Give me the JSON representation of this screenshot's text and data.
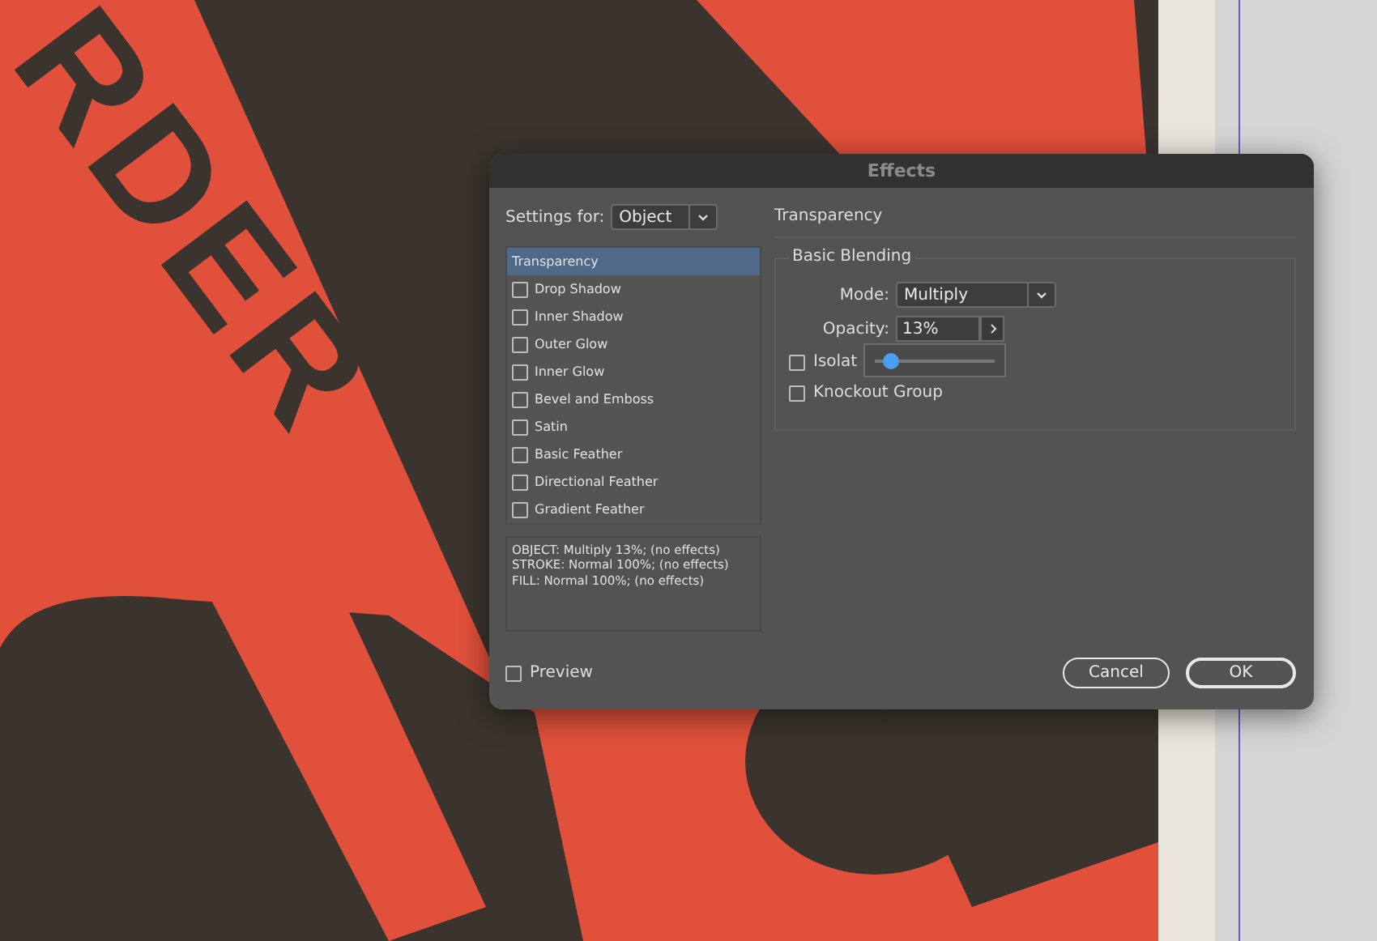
{
  "artwork": {
    "headline": "RDER"
  },
  "dialog": {
    "title": "Effects",
    "settings_for": {
      "label": "Settings for:",
      "value": "Object"
    },
    "effects": [
      {
        "kind": "plain",
        "label": "Transparency",
        "selected": true
      },
      {
        "kind": "checkbox",
        "label": "Drop Shadow",
        "checked": false,
        "selected": false
      },
      {
        "kind": "checkbox",
        "label": "Inner Shadow",
        "checked": false,
        "selected": false
      },
      {
        "kind": "checkbox",
        "label": "Outer Glow",
        "checked": false,
        "selected": false
      },
      {
        "kind": "checkbox",
        "label": "Inner Glow",
        "checked": false,
        "selected": false
      },
      {
        "kind": "checkbox",
        "label": "Bevel and Emboss",
        "checked": false,
        "selected": false
      },
      {
        "kind": "checkbox",
        "label": "Satin",
        "checked": false,
        "selected": false
      },
      {
        "kind": "checkbox",
        "label": "Basic Feather",
        "checked": false,
        "selected": false
      },
      {
        "kind": "checkbox",
        "label": "Directional Feather",
        "checked": false,
        "selected": false
      },
      {
        "kind": "checkbox",
        "label": "Gradient Feather",
        "checked": false,
        "selected": false
      }
    ],
    "summary": [
      "OBJECT: Multiply 13%; (no effects)",
      "STROKE: Normal 100%; (no effects)",
      "FILL: Normal 100%; (no effects)"
    ],
    "preview": {
      "label": "Preview",
      "checked": false
    },
    "section_title": "Transparency",
    "group_title": "Basic Blending",
    "mode": {
      "label": "Mode:",
      "value": "Multiply"
    },
    "opacity": {
      "label": "Opacity:",
      "value": "13%",
      "level": 0.13
    },
    "options": [
      {
        "label": "Isolat",
        "checked": false
      },
      {
        "label": "Knockout Group",
        "checked": false
      }
    ],
    "buttons": [
      {
        "label": "Cancel",
        "default": false
      },
      {
        "label": "OK",
        "default": true
      }
    ]
  }
}
